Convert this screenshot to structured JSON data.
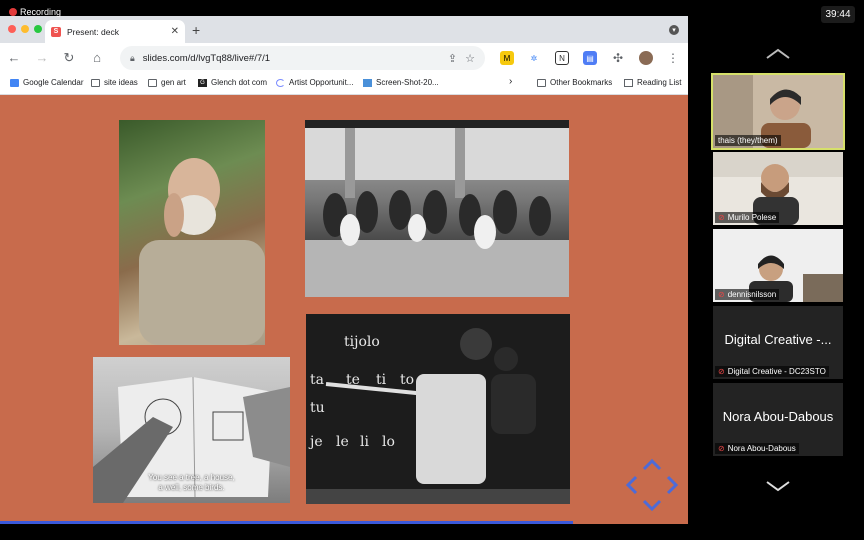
{
  "recording": {
    "label": "Recording"
  },
  "clock": "39:44",
  "browser": {
    "tab": {
      "title": "Present: deck",
      "favicon": "S"
    },
    "url": "slides.com/d/lvgTq88/live#/7/1",
    "bookmarks": [
      {
        "label": "Google Calendar",
        "icon": "calendar-icon"
      },
      {
        "label": "site ideas",
        "icon": "folder-icon"
      },
      {
        "label": "gen art",
        "icon": "folder-icon"
      },
      {
        "label": "Glench dot com",
        "icon": "g-icon"
      },
      {
        "label": "Artist Opportunit...",
        "icon": "loader-icon"
      },
      {
        "label": "Screen-Shot-20...",
        "icon": "image-icon"
      }
    ],
    "other_bookmarks": "Other Bookmarks",
    "reading_list": "Reading List"
  },
  "slide": {
    "background": "#c86b4c",
    "caption": "You see a tree, a house,\na well, some birds.",
    "board_words": [
      "tijolo",
      "ta",
      "te",
      "ti",
      "to",
      "tu",
      "je",
      "le",
      "li",
      "lo"
    ]
  },
  "participants": [
    {
      "name": "thais (they/them)",
      "muted": false,
      "active": true
    },
    {
      "name": "Murilo Polese",
      "muted": true
    },
    {
      "name": "dennisnilsson",
      "muted": true
    },
    {
      "name": "Digital Creative - DC23STO",
      "display": "Digital Creative -...",
      "muted": true
    },
    {
      "name": "Nora Abou-Dabous",
      "display": "Nora Abou-Dabous",
      "muted": true
    }
  ]
}
